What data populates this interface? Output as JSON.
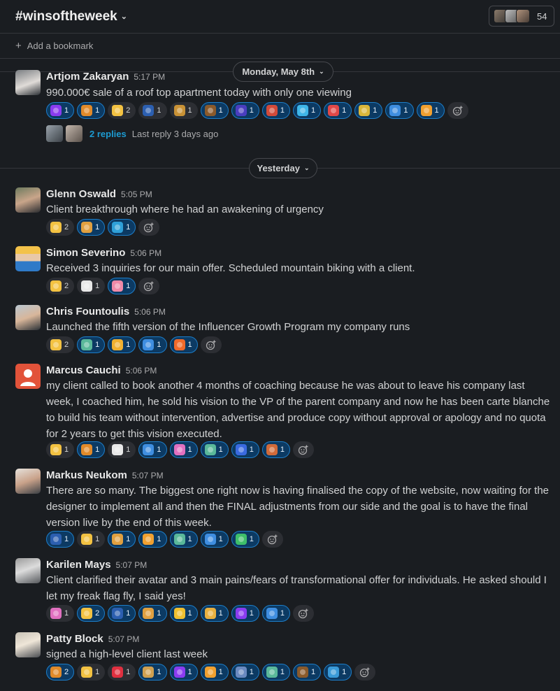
{
  "channel": {
    "hash": "#",
    "name": "winsoftheweek",
    "member_count": "54"
  },
  "bookmark": {
    "label": "Add a bookmark"
  },
  "dates": {
    "first": "Monday, May 8th",
    "second": "Yesterday"
  },
  "thread": {
    "replies": "2 replies",
    "last_reply": "Last reply 3 days ago"
  },
  "messages": [
    {
      "name": "Artjom Zakaryan",
      "time": "5:17 PM",
      "text": "990.000€ sale of a roof top apartment today with only one viewing",
      "reactions": [
        {
          "emoji": "purple-grid",
          "color": "#8b3cf0",
          "count": "1",
          "mine": true
        },
        {
          "emoji": "tiger-face",
          "color": "#e08a2a",
          "count": "1",
          "mine": true
        },
        {
          "emoji": "thumbs-up",
          "color": "#f3c242",
          "count": "2",
          "mine": false
        },
        {
          "emoji": "superhero",
          "color": "#2c5fb0",
          "count": "1",
          "mine": false
        },
        {
          "emoji": "leopard",
          "color": "#c99236",
          "count": "1",
          "mine": false
        },
        {
          "emoji": "monkey",
          "color": "#8a5a2b",
          "count": "1",
          "mine": true
        },
        {
          "emoji": "wizard",
          "color": "#4a3ec0",
          "count": "1",
          "mine": true
        },
        {
          "emoji": "skier",
          "color": "#d24a3a",
          "count": "1",
          "mine": true
        },
        {
          "emoji": "gem",
          "color": "#3fb6e8",
          "count": "1",
          "mine": true
        },
        {
          "emoji": "target",
          "color": "#e04848",
          "count": "1",
          "mine": true
        },
        {
          "emoji": "champagne",
          "color": "#d9b63a",
          "count": "1",
          "mine": true
        },
        {
          "emoji": "ship-it",
          "color": "#3f8ee0",
          "count": "1",
          "mine": true
        },
        {
          "emoji": "tada-face",
          "color": "#f0a030",
          "count": "1",
          "mine": true
        }
      ]
    },
    {
      "name": "Glenn Oswald",
      "time": "5:05 PM",
      "text": "Client breakthrough where he had an awakening of urgency",
      "reactions": [
        {
          "emoji": "clap",
          "color": "#f3c242",
          "count": "2",
          "mine": false
        },
        {
          "emoji": "person-lifting",
          "color": "#e0a040",
          "count": "1",
          "mine": true
        },
        {
          "emoji": "wave",
          "color": "#2fa0d8",
          "count": "1",
          "mine": true
        }
      ]
    },
    {
      "name": "Simon Severino",
      "time": "5:06 PM",
      "text": "Received 3  inquiries for our main offer. Scheduled mountain biking with a client.",
      "reactions": [
        {
          "emoji": "clap",
          "color": "#f3c242",
          "count": "2",
          "mine": false
        },
        {
          "emoji": "dice",
          "color": "#e8e8e8",
          "count": "1",
          "mine": false
        },
        {
          "emoji": "pig",
          "color": "#f08aa8",
          "count": "1",
          "mine": true
        }
      ]
    },
    {
      "name": "Chris Fountoulis",
      "time": "5:06 PM",
      "text": "Launched the fifth version of the Influencer Growth Program my company runs",
      "reactions": [
        {
          "emoji": "clap",
          "color": "#f3c242",
          "count": "2",
          "mine": false
        },
        {
          "emoji": "statue",
          "color": "#5ab89a",
          "count": "1",
          "mine": true
        },
        {
          "emoji": "cool-face",
          "color": "#f0b030",
          "count": "1",
          "mine": true
        },
        {
          "emoji": "ship-it",
          "color": "#3f8ee0",
          "count": "1",
          "mine": true
        },
        {
          "emoji": "fire",
          "color": "#f06a2a",
          "count": "1",
          "mine": true
        }
      ]
    },
    {
      "name": "Marcus Cauchi",
      "time": "5:06 PM",
      "text": "my client called to book another 4 months of coaching because he was about to leave his company last week, I coached him, he sold his vision to the VP of the parent company and now he has been carte blanche to build his team without intervention, advertise and produce copy without approval or apology and no quota for 2 years to get this vision executed.",
      "reactions": [
        {
          "emoji": "clap",
          "color": "#f3c242",
          "count": "1",
          "mine": false
        },
        {
          "emoji": "tiger-face",
          "color": "#e08a2a",
          "count": "1",
          "mine": true
        },
        {
          "emoji": "dice",
          "color": "#e8e8e8",
          "count": "1",
          "mine": false
        },
        {
          "emoji": "ship-it",
          "color": "#3f8ee0",
          "count": "1",
          "mine": true
        },
        {
          "emoji": "pink-cat",
          "color": "#e070c0",
          "count": "1",
          "mine": true
        },
        {
          "emoji": "statue",
          "color": "#5ab89a",
          "count": "1",
          "mine": true
        },
        {
          "emoji": "pin",
          "color": "#3a6ae0",
          "count": "1",
          "mine": true
        },
        {
          "emoji": "mountain",
          "color": "#d06a3a",
          "count": "1",
          "mine": true
        }
      ]
    },
    {
      "name": "Markus Neukom",
      "time": "5:07 PM",
      "text": "There are so many. The biggest one right now is having finalised the copy of the website, now waiting for the designer to implement all and then the FINAL adjustments from our side and the goal is to have the final version live by the end of this week.",
      "reactions": [
        {
          "emoji": "superhero",
          "color": "#2c5fb0",
          "count": "1",
          "mine": true
        },
        {
          "emoji": "clap",
          "color": "#f3c242",
          "count": "1",
          "mine": false
        },
        {
          "emoji": "person-lifting",
          "color": "#e0a040",
          "count": "1",
          "mine": true
        },
        {
          "emoji": "tada-face",
          "color": "#f0a030",
          "count": "1",
          "mine": true
        },
        {
          "emoji": "statue",
          "color": "#5ab89a",
          "count": "1",
          "mine": true
        },
        {
          "emoji": "ship-it",
          "color": "#3f8ee0",
          "count": "1",
          "mine": true
        },
        {
          "emoji": "ty-badge",
          "color": "#3fbf6a",
          "count": "1",
          "mine": true
        }
      ]
    },
    {
      "name": "Karilen Mays",
      "time": "5:07 PM",
      "text": "Client clarified their avatar and 3 main pains/fears of transformational offer for individuals. He asked should I let my freak flag fly, I said yes!",
      "reactions": [
        {
          "emoji": "pink-cat",
          "color": "#e070c0",
          "count": "1",
          "mine": false
        },
        {
          "emoji": "clap",
          "color": "#f3c242",
          "count": "2",
          "mine": true
        },
        {
          "emoji": "superhero",
          "color": "#2c5fb0",
          "count": "1",
          "mine": true
        },
        {
          "emoji": "person-lifting",
          "color": "#e0a040",
          "count": "1",
          "mine": true
        },
        {
          "emoji": "sunglasses-face",
          "color": "#f0c030",
          "count": "1",
          "mine": true
        },
        {
          "emoji": "person-standing",
          "color": "#e8b040",
          "count": "1",
          "mine": true
        },
        {
          "emoji": "purple-grid",
          "color": "#8b3cf0",
          "count": "1",
          "mine": true
        },
        {
          "emoji": "ship-it",
          "color": "#3f8ee0",
          "count": "1",
          "mine": true
        }
      ]
    },
    {
      "name": "Patty Block",
      "time": "5:07 PM",
      "text": "signed a high-level client last week",
      "reactions": [
        {
          "emoji": "tiger-face",
          "color": "#e08a2a",
          "count": "2",
          "mine": true
        },
        {
          "emoji": "clap",
          "color": "#f3c242",
          "count": "1",
          "mine": false
        },
        {
          "emoji": "heart-exclamation",
          "color": "#e03040",
          "count": "1",
          "mine": false
        },
        {
          "emoji": "deer",
          "color": "#d0a050",
          "count": "1",
          "mine": true
        },
        {
          "emoji": "purple-grid",
          "color": "#8b3cf0",
          "count": "1",
          "mine": true
        },
        {
          "emoji": "tada-face",
          "color": "#f0a030",
          "count": "1",
          "mine": true
        },
        {
          "emoji": "runner",
          "color": "#6a8ac0",
          "count": "1",
          "mine": true
        },
        {
          "emoji": "statue",
          "color": "#5ab89a",
          "count": "1",
          "mine": true
        },
        {
          "emoji": "monkey",
          "color": "#8a5a2b",
          "count": "1",
          "mine": true
        },
        {
          "emoji": "whale",
          "color": "#3a9ad8",
          "count": "1",
          "mine": true
        }
      ]
    }
  ]
}
